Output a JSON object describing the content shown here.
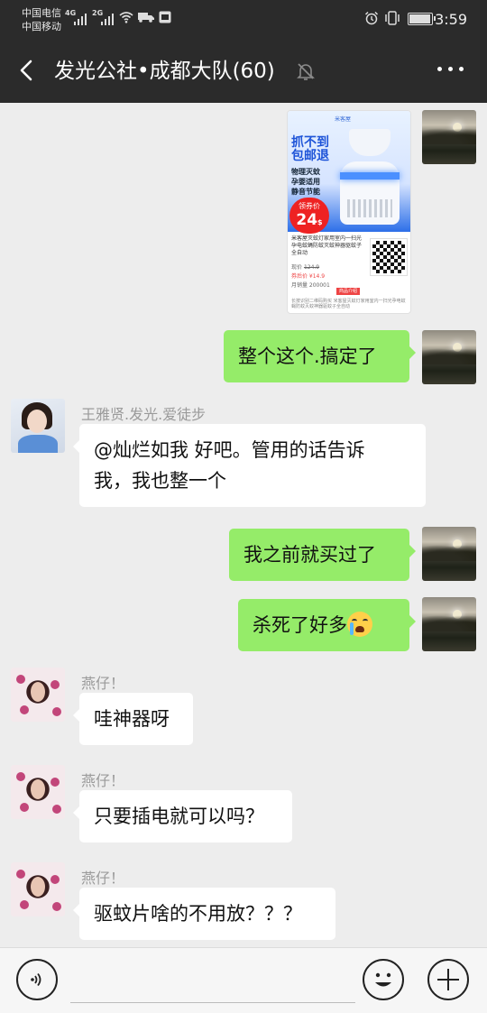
{
  "status_bar": {
    "carrier_1": "中国电信",
    "carrier_2": "中国移动",
    "net_1": "4G",
    "net_2": "2G",
    "time": "3:59",
    "battery_level": 0.9
  },
  "header": {
    "title": "发光公社•成都大队(60)",
    "muted_icon": "bell-mute-icon",
    "more_icon": "more-dots-icon",
    "back_icon": "chevron-left-icon"
  },
  "product_card": {
    "logo": "米客屋",
    "headline_1": "抓不到",
    "headline_2": "包邮退",
    "features": [
      "物理灭蚊",
      "孕婴适用",
      "静音节能"
    ],
    "coupon_label": "领券价",
    "price": "24",
    "price_unit": "$",
    "desc": "米客屋灭蚊灯家用室内一扫光孕电蚊蝇防蚊灭蚊神器驱蚊子全自动",
    "orig_price_label": "现价",
    "orig_price": "124.9",
    "coupon_row": "券后价 ¥14.9",
    "stock": "月销量 200001",
    "btn": "商品介绍",
    "footer": "长按识别二维码购买 米客屋灭蚊灯家用室内一扫光孕电蚊蝇防蚊灭蚊神器驱蚊子全自动"
  },
  "messages": [
    {
      "side": "right",
      "sender": "me",
      "text": "整个这个.搞定了"
    },
    {
      "side": "left",
      "sender": "王雅贤.发光.爱徒步",
      "text_line1": "@灿烂如我  好吧。管用的话告诉",
      "text_line2": "我，我也整一个"
    },
    {
      "side": "right",
      "sender": "me",
      "text": "我之前就买过了"
    },
    {
      "side": "right",
      "sender": "me",
      "text": "杀死了好多",
      "emoji": "crying-emoji"
    },
    {
      "side": "left",
      "sender": "燕仔！",
      "text": "哇神器呀"
    },
    {
      "side": "left",
      "sender": "燕仔！",
      "text": "只要插电就可以吗？"
    },
    {
      "side": "left",
      "sender": "燕仔！",
      "text": "驱蚊片啥的不用放？？？"
    }
  ],
  "input_bar": {
    "voice_icon": "voice-icon",
    "emoji_icon": "emoji-icon",
    "plus_icon": "plus-icon",
    "placeholder": ""
  }
}
